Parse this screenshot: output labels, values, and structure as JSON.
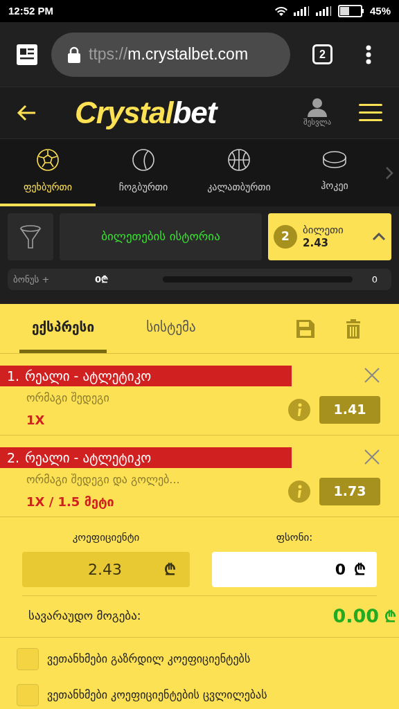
{
  "status_bar": {
    "time": "12:52 PM",
    "battery": "45%"
  },
  "browser": {
    "url_scheme": "ttps://",
    "url_host": "m.crystalbet.com",
    "tab_count": "2"
  },
  "header": {
    "logo_part_1": "Crystal",
    "logo_part_2": "bet",
    "login": "შესვლა"
  },
  "sports": [
    {
      "label": "ფეხბურთი",
      "kind": "soccer",
      "selected": true
    },
    {
      "label": "ჩოგბურთი",
      "kind": "tennis",
      "selected": false
    },
    {
      "label": "კალათბურთი",
      "kind": "basketball",
      "selected": false
    },
    {
      "label": "ჰოკეი",
      "kind": "hockey",
      "selected": false
    }
  ],
  "history_button": "ბილეთების ისტორია",
  "ticket": {
    "count": "2",
    "label": "ბილეთი",
    "odds": "2.43"
  },
  "bonus": {
    "label": "ბონუს +",
    "amount": "0₾",
    "level": 0,
    "value": "0"
  },
  "bet_tabs": [
    {
      "label": "ექსპრესი",
      "selected": true
    },
    {
      "label": "სისტემა",
      "selected": false
    }
  ],
  "bets": [
    {
      "number": "1.",
      "match": "რეალი - ატლეტიკო",
      "market": "ორმაგი შედეგი",
      "pick": "1X",
      "odds": "1.41"
    },
    {
      "number": "2.",
      "match": "რეალი - ატლეტიკო",
      "market": "ორმაგი შედეგი და გოლებ...",
      "pick": "1X / 1.5 მეტი",
      "odds": "1.73"
    }
  ],
  "coefficient": {
    "label": "კოეფიციენტი",
    "value": "2.43",
    "currency": "₾"
  },
  "stake": {
    "label": "ფსონი:",
    "value": "0",
    "currency": "₾"
  },
  "possible_win": {
    "label": "სავარაუდო მოგება:",
    "value": "0.00",
    "currency": "₾"
  },
  "options": [
    {
      "label": "ვეთანხმები გაზრდილ კოეფიციენტებს",
      "checked": false
    },
    {
      "label": "ვეთანხმები კოეფიციენტების ცვლილებას",
      "checked": false
    }
  ]
}
